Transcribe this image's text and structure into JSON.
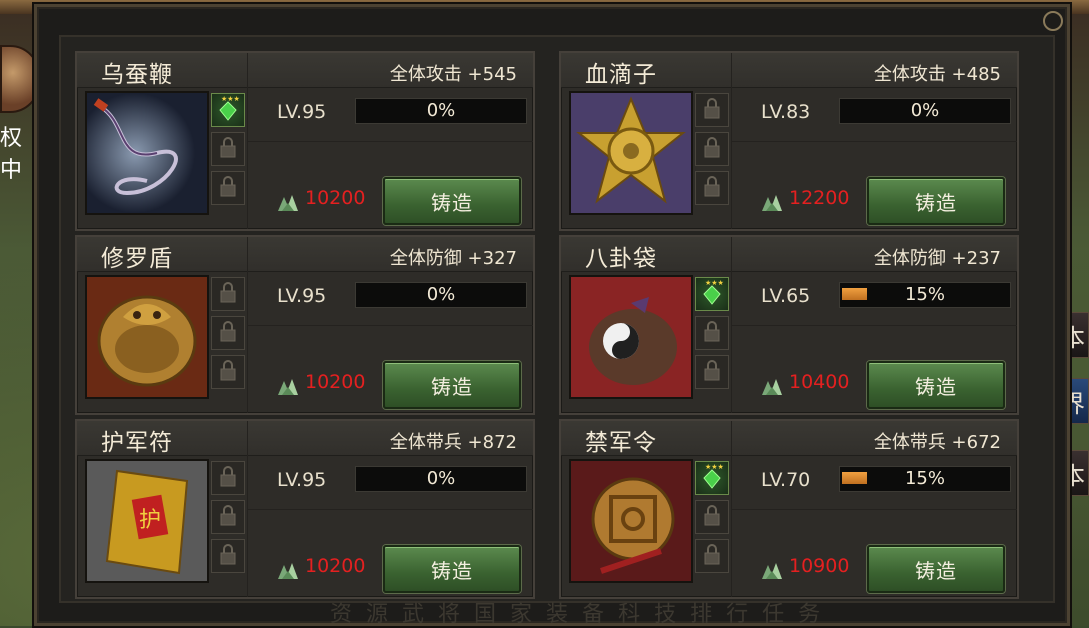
{
  "left_edge_text": "权中",
  "side_buttons": [
    "本",
    "界",
    "本"
  ],
  "bottom_nav": [
    "资源",
    "武将",
    "国家",
    "装备",
    "科技",
    "排行",
    "任务"
  ],
  "forge_label": "铸造",
  "items": [
    {
      "name": "乌蚕鞭",
      "bonus": "全体攻击 +545",
      "level": "LV.95",
      "progress_text": "0%",
      "progress": 0,
      "cost": "10200",
      "gems": [
        true,
        false,
        false
      ],
      "icon": "whip-icon",
      "art": "whip"
    },
    {
      "name": "血滴子",
      "bonus": "全体攻击 +485",
      "level": "LV.83",
      "progress_text": "0%",
      "progress": 0,
      "cost": "12200",
      "gems": [
        false,
        false,
        false
      ],
      "icon": "star-medallion-icon",
      "art": "medallion"
    },
    {
      "name": "修罗盾",
      "bonus": "全体防御 +327",
      "level": "LV.95",
      "progress_text": "0%",
      "progress": 0,
      "cost": "10200",
      "gems": [
        false,
        false,
        false
      ],
      "icon": "shield-icon",
      "art": "shield"
    },
    {
      "name": "八卦袋",
      "bonus": "全体防御 +237",
      "level": "LV.65",
      "progress_text": "15%",
      "progress": 0.15,
      "cost": "10400",
      "gems": [
        true,
        false,
        false
      ],
      "icon": "bagua-bag-icon",
      "art": "bag"
    },
    {
      "name": "护军符",
      "bonus": "全体带兵 +872",
      "level": "LV.95",
      "progress_text": "0%",
      "progress": 0,
      "cost": "10200",
      "gems": [
        false,
        false,
        false
      ],
      "icon": "talisman-icon",
      "art": "talisman"
    },
    {
      "name": "禁军令",
      "bonus": "全体带兵 +672",
      "level": "LV.70",
      "progress_text": "15%",
      "progress": 0.15,
      "cost": "10900",
      "gems": [
        true,
        false,
        false
      ],
      "icon": "command-token-icon",
      "art": "token"
    }
  ]
}
